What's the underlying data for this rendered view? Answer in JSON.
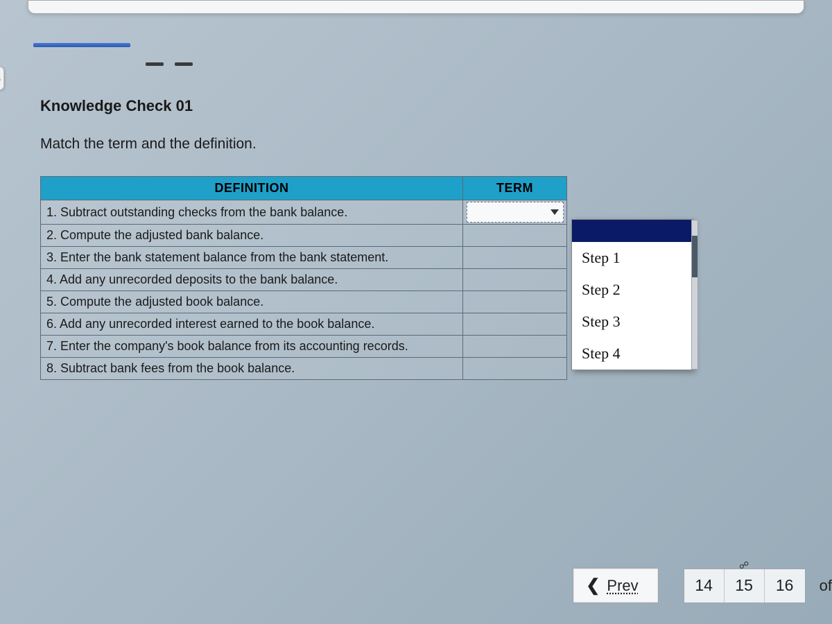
{
  "left_tab_char": "s",
  "header": {
    "title": "Knowledge Check 01",
    "instruction": "Match the term and the definition."
  },
  "table": {
    "headers": {
      "definition": "DEFINITION",
      "term": "TERM"
    },
    "rows": [
      "1. Subtract outstanding checks from the bank balance.",
      "2. Compute the adjusted bank balance.",
      "3. Enter the bank statement balance from the bank statement.",
      "4. Add any unrecorded deposits to the bank balance.",
      "5. Compute the adjusted book balance.",
      "6. Add any unrecorded interest earned to the book balance.",
      "7. Enter the company's book balance from its accounting records.",
      "8. Subtract bank fees from the book balance."
    ]
  },
  "dropdown": {
    "options": [
      "",
      "Step 1",
      "Step 2",
      "Step 3",
      "Step 4"
    ],
    "selected_index": 0
  },
  "nav": {
    "prev_label": "Prev",
    "pages": [
      "14",
      "15",
      "16"
    ],
    "linked_index": 1,
    "of_label": "of"
  }
}
